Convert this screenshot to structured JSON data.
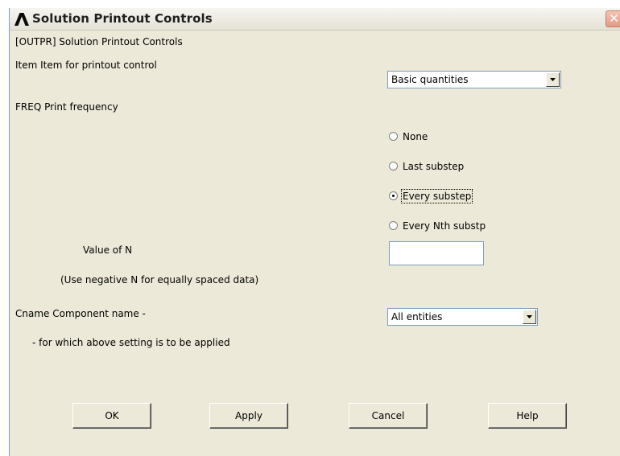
{
  "window": {
    "title": "Solution Printout Controls",
    "close_glyph": "✕"
  },
  "form": {
    "header": "[OUTPR]  Solution Printout Controls",
    "item_label": "Item   Item for printout control",
    "item_value": "Basic quantities",
    "freq_label": "FREQ   Print frequency",
    "freq_options": [
      {
        "label": "None",
        "selected": false
      },
      {
        "label": "Last substep",
        "selected": false
      },
      {
        "label": "Every substep",
        "selected": true
      },
      {
        "label": "Every Nth substp",
        "selected": false
      }
    ],
    "n_label": "Value of N",
    "n_hint": "(Use negative N for equally spaced data)",
    "n_value": "",
    "cname_label": "Cname   Component name -",
    "cname_value": "All entities",
    "cname_hint": "- for which above setting is to be applied"
  },
  "buttons": {
    "ok": "OK",
    "apply": "Apply",
    "cancel": "Cancel",
    "help": "Help"
  },
  "colors": {
    "dialog_bg": "#ece9d8",
    "logo": "#0a0a0a"
  }
}
